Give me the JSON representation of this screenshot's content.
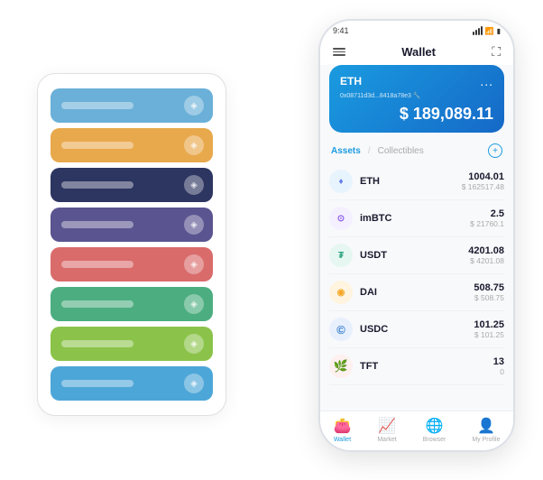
{
  "scene": {
    "background": "#ffffff"
  },
  "card_stack": {
    "items": [
      {
        "color": "#6ab0d8",
        "dot_symbol": "◈"
      },
      {
        "color": "#e8a84c",
        "dot_symbol": "◈"
      },
      {
        "color": "#2d3561",
        "dot_symbol": "◈"
      },
      {
        "color": "#5a5490",
        "dot_symbol": "◈"
      },
      {
        "color": "#d96b6b",
        "dot_symbol": "◈"
      },
      {
        "color": "#4cae80",
        "dot_symbol": "◈"
      },
      {
        "color": "#8bc34a",
        "dot_symbol": "◈"
      },
      {
        "color": "#4da6d8",
        "dot_symbol": "◈"
      }
    ]
  },
  "phone": {
    "status": {
      "time": "9:41",
      "signal": "●●●",
      "wifi": "wifi",
      "battery": "battery"
    },
    "header": {
      "menu_icon": "≡",
      "title": "Wallet",
      "expand_icon": "⛶"
    },
    "eth_card": {
      "label": "ETH",
      "address": "0x08711d3d...8418a78e3 🔧",
      "balance": "$ 189,089.11",
      "dollar_sign": "$",
      "more_icon": "..."
    },
    "assets": {
      "tab_active": "Assets",
      "tab_divider": "/",
      "tab_inactive": "Collectibles",
      "add_icon": "+"
    },
    "asset_list": [
      {
        "name": "ETH",
        "amount": "1004.01",
        "usd": "$ 162517.48",
        "icon_text": "♦",
        "icon_class": "icon-eth"
      },
      {
        "name": "imBTC",
        "amount": "2.5",
        "usd": "$ 21760.1",
        "icon_text": "⊙",
        "icon_class": "icon-imbtc"
      },
      {
        "name": "USDT",
        "amount": "4201.08",
        "usd": "$ 4201.08",
        "icon_text": "₮",
        "icon_class": "icon-usdt"
      },
      {
        "name": "DAI",
        "amount": "508.75",
        "usd": "$ 508.75",
        "icon_text": "◉",
        "icon_class": "icon-dai"
      },
      {
        "name": "USDC",
        "amount": "101.25",
        "usd": "$ 101.25",
        "icon_text": "©",
        "icon_class": "icon-usdc"
      },
      {
        "name": "TFT",
        "amount": "13",
        "usd": "0",
        "icon_text": "🌿",
        "icon_class": "icon-tft"
      }
    ],
    "bottom_nav": [
      {
        "label": "Wallet",
        "icon": "👛",
        "active": true
      },
      {
        "label": "Market",
        "icon": "📊",
        "active": false
      },
      {
        "label": "Browser",
        "icon": "🌐",
        "active": false
      },
      {
        "label": "My Profile",
        "icon": "👤",
        "active": false
      }
    ]
  }
}
